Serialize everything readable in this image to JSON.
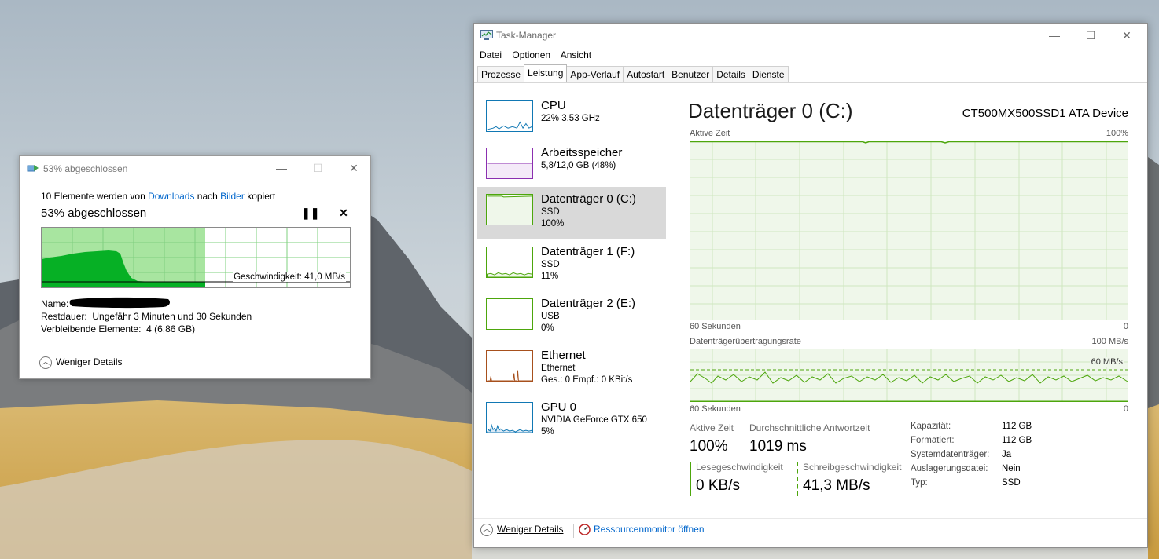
{
  "copy_dialog": {
    "title": "53% abgeschlossen",
    "line_prefix": "10 Elemente werden von ",
    "source": "Downloads",
    "line_mid": " nach ",
    "target": "Bilder",
    "line_suffix": " kopiert",
    "status": "53% abgeschlossen",
    "progress": 0.53,
    "speed_label": "Geschwindigkeit: 41,0 MB/s",
    "name_label": "Name:",
    "remaining_label": "Restdauer:",
    "remaining_value": "Ungefähr 3 Minuten und 30 Sekunden",
    "items_label": "Verbleibende Elemente:",
    "items_value": "4 (6,86 GB)",
    "details_toggle": "Weniger Details",
    "colors": {
      "fill": "#06b025",
      "fill_light": "#a8e5a0",
      "grid": "#7fd07f"
    }
  },
  "taskmgr": {
    "title": "Task-Manager",
    "menu": [
      "Datei",
      "Optionen",
      "Ansicht"
    ],
    "tabs": [
      "Prozesse",
      "Leistung",
      "App-Verlauf",
      "Autostart",
      "Benutzer",
      "Details",
      "Dienste"
    ],
    "active_tab": 1,
    "sidebar": [
      {
        "name": "CPU",
        "sub1": "22%  3,53 GHz",
        "sub2": "",
        "color": "#1178b4"
      },
      {
        "name": "Arbeitsspeicher",
        "sub1": "5,8/12,0 GB (48%)",
        "sub2": "",
        "color": "#8b2fb0"
      },
      {
        "name": "Datenträger 0 (C:)",
        "sub1": "SSD",
        "sub2": "100%",
        "color": "#4da60c"
      },
      {
        "name": "Datenträger 1 (F:)",
        "sub1": "SSD",
        "sub2": "11%",
        "color": "#4da60c"
      },
      {
        "name": "Datenträger 2 (E:)",
        "sub1": "USB",
        "sub2": "0%",
        "color": "#4da60c"
      },
      {
        "name": "Ethernet",
        "sub1": "Ethernet",
        "sub2": "Ges.: 0  Empf.: 0 KBit/s",
        "color": "#a7501d"
      },
      {
        "name": "GPU 0",
        "sub1": "NVIDIA GeForce GTX 650",
        "sub2": "5%",
        "color": "#1178b4"
      }
    ],
    "selected_index": 2,
    "main": {
      "title": "Datenträger 0 (C:)",
      "device": "CT500MX500SSD1 ATA Device",
      "graph1_label": "Aktive Zeit",
      "graph1_max": "100%",
      "graph1_time": "60 Sekunden",
      "graph1_min": "0",
      "graph2_label": "Datenträgerübertragungsrate",
      "graph2_max": "100 MB/s",
      "graph2_line": "60 MB/s",
      "graph2_time": "60 Sekunden",
      "graph2_min": "0",
      "active_time_label": "Aktive Zeit",
      "active_time_value": "100%",
      "response_label": "Durchschnittliche Antwortzeit",
      "response_value": "1019 ms",
      "read_label": "Lesegeschwindigkeit",
      "read_value": "0 KB/s",
      "write_label": "Schreibgeschwindigkeit",
      "write_value": "41,3 MB/s",
      "props": [
        {
          "k": "Kapazität:",
          "v": "112 GB"
        },
        {
          "k": "Formatiert:",
          "v": "112 GB"
        },
        {
          "k": "Systemdatenträger:",
          "v": "Ja"
        },
        {
          "k": "Auslagerungsdatei:",
          "v": "Nein"
        },
        {
          "k": "Typ:",
          "v": "SSD"
        }
      ]
    },
    "footer_details": "Weniger Details",
    "footer_monitor": "Ressourcenmonitor öffnen",
    "colors": {
      "disk": "#4da60c",
      "disk_fill": "#eff7ea",
      "grid": "#cfe7c0"
    }
  }
}
